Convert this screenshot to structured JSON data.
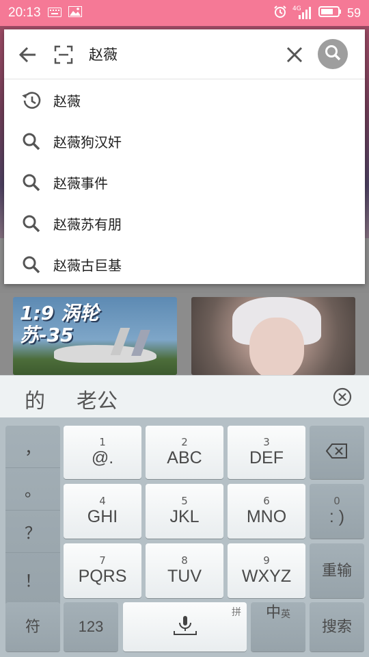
{
  "status_bar": {
    "time": "20:13",
    "network": "4G",
    "battery": "59"
  },
  "search": {
    "query": "赵薇"
  },
  "suggestions": [
    {
      "icon": "history-icon",
      "text": "赵薇"
    },
    {
      "icon": "search-icon",
      "text": "赵薇狗汉奸"
    },
    {
      "icon": "search-icon",
      "text": "赵薇事件"
    },
    {
      "icon": "search-icon",
      "text": "赵薇苏有朋"
    },
    {
      "icon": "search-icon",
      "text": "赵薇古巨基"
    }
  ],
  "background": {
    "card_left_text": "1:9 涡轮\n苏-35"
  },
  "candidates": [
    "的",
    "老公"
  ],
  "keyboard": {
    "punctuation": [
      "，",
      "。",
      "？",
      "！"
    ],
    "keys": [
      {
        "num": "1",
        "label": "@."
      },
      {
        "num": "2",
        "label": "ABC"
      },
      {
        "num": "3",
        "label": "DEF"
      },
      {
        "num": "4",
        "label": "GHI"
      },
      {
        "num": "5",
        "label": "JKL"
      },
      {
        "num": "6",
        "label": "MNO"
      },
      {
        "num": "7",
        "label": "PQRS"
      },
      {
        "num": "8",
        "label": "TUV"
      },
      {
        "num": "9",
        "label": "WXYZ"
      }
    ],
    "zero_key": {
      "num": "0",
      "label": ": )"
    },
    "retype_label": "重输",
    "symbol_label": "符",
    "numeric_label": "123",
    "pinyin_tag": "拼",
    "lang_main": "中",
    "lang_sub": "英",
    "search_label": "搜索"
  },
  "colors": {
    "status_bar": "#f57996",
    "search_button": "#9e9e9e",
    "keyboard_bg": "#b5c0c6"
  }
}
